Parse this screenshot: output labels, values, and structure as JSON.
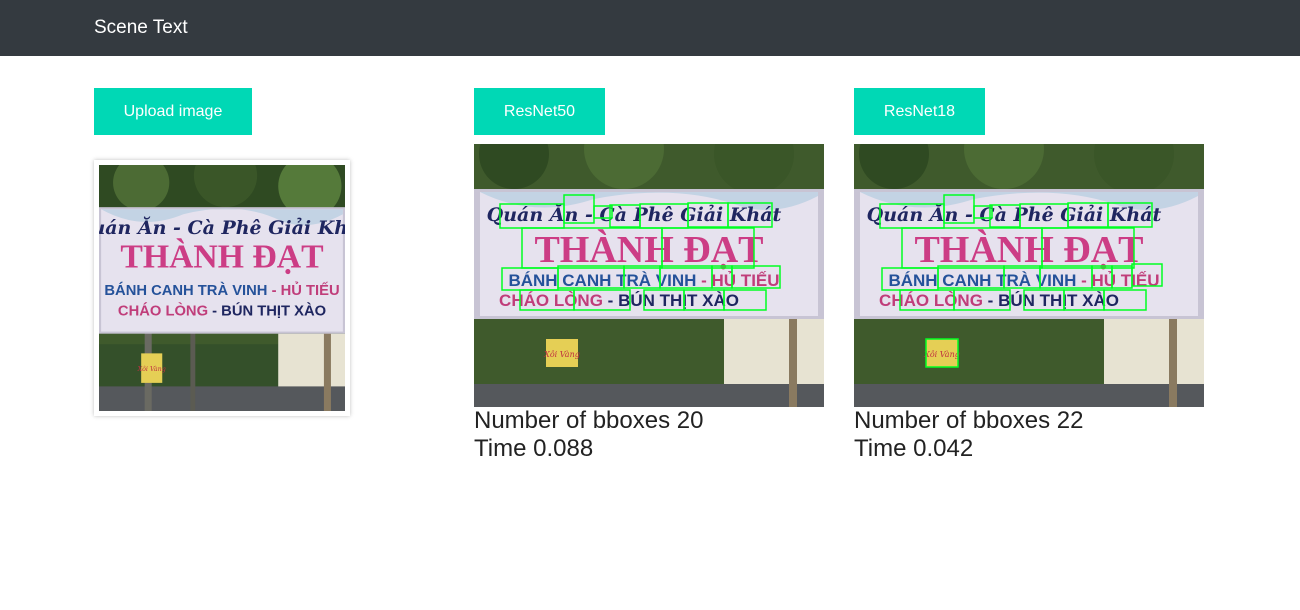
{
  "navbar": {
    "brand": "Scene Text"
  },
  "upload": {
    "button_label": "Upload image"
  },
  "sign": {
    "line1": "Quán Ăn - Cà Phê Giải Khát",
    "title": "THÀNH ĐẠT",
    "line3a": "BÁNH CANH TRÀ VINH",
    "line3b": "HỦ TIẾU",
    "line4a": "CHÁO LÒNG",
    "line4b": "BÚN THỊT XÀO",
    "small_sign": "Xôi Vàng"
  },
  "results": [
    {
      "button_label": "ResNet50",
      "bbox_label": "Number of bboxes 20",
      "time_label": "Time 0.088"
    },
    {
      "button_label": "ResNet18",
      "bbox_label": "Number of bboxes 22",
      "time_label": "Time 0.042"
    }
  ],
  "colors": {
    "navbar": "#343a40",
    "accent": "#00d8b5",
    "bbox": "#00ff22"
  }
}
